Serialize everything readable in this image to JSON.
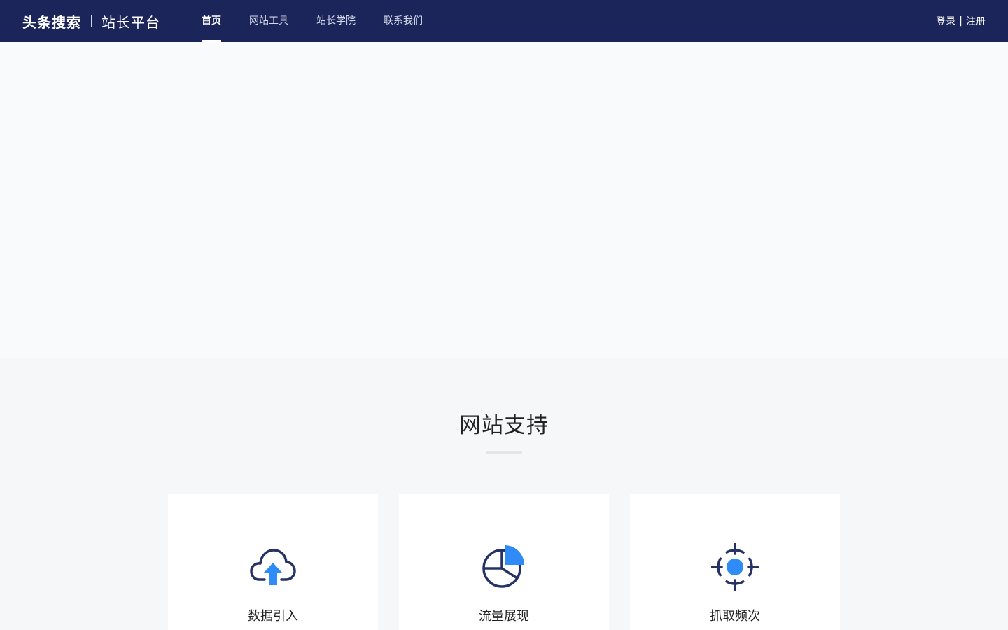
{
  "header": {
    "brand_main": "头条搜索",
    "brand_sub": "站长平台",
    "nav": [
      {
        "label": "首页",
        "active": true
      },
      {
        "label": "网站工具"
      },
      {
        "label": "站长学院"
      },
      {
        "label": "联系我们"
      }
    ],
    "login": "登录",
    "separator": "|",
    "register": "注册"
  },
  "support": {
    "title": "网站支持",
    "cards": [
      {
        "label": "数据引入",
        "icon": "cloud-upload-icon"
      },
      {
        "label": "流量展现",
        "icon": "pie-chart-icon"
      },
      {
        "label": "抓取频次",
        "icon": "crosshair-icon"
      }
    ]
  },
  "colors": {
    "header_bg": "#1b2559",
    "accent_blue": "#2f8bf5",
    "icon_navy": "#263266"
  }
}
